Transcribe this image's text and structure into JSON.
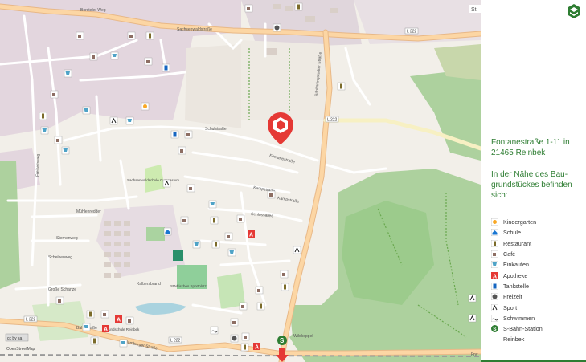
{
  "map": {
    "roads": [
      "Sachsenwaldstraße",
      "Borsteler Weg",
      "Schulstraße",
      "Schönningstedter Straße",
      "Fontanestraße",
      "Mühlenredder",
      "Kampstraße",
      "Sternenweg",
      "Scheibenweg",
      "Schlossallee",
      "Kalbersbrand",
      "Hamburger Straße",
      "Große Schanze",
      "Bahnstraße",
      "Wildkoppel",
      "Freiheitsweg",
      "Kampstraße"
    ],
    "road_badges": [
      "L 222",
      "L 222",
      "L 222",
      "L 222"
    ],
    "places": [
      "Grundschule Reinbek",
      "Sachsenwaldschule Gymnasium",
      "Städtisches Sportplatz"
    ],
    "attribution": "OpenStreetMap",
    "license_badge": "cc by sa",
    "top_label": "St",
    "bottom_label": "Fnv"
  },
  "colors": {
    "accent": "#2e7d32",
    "marker": "#e53935"
  },
  "sidebar": {
    "address_line1": "Fontanestraße 1-11 in",
    "address_line2": "21465 Reinbek",
    "intro_line1": "In der Nähe des Bau-",
    "intro_line2": "grundstückes befinden",
    "intro_line3": "sich:"
  },
  "legend": [
    {
      "icon": "kindergarten-icon",
      "label": "Kindergarten"
    },
    {
      "icon": "school-icon",
      "label": "Schule"
    },
    {
      "icon": "restaurant-icon",
      "label": "Restaurant"
    },
    {
      "icon": "cafe-icon",
      "label": "Café"
    },
    {
      "icon": "shopping-cart-icon",
      "label": "Einkaufen"
    },
    {
      "icon": "pharmacy-icon",
      "label": "Apotheke"
    },
    {
      "icon": "fuel-station-icon",
      "label": "Tankstelle"
    },
    {
      "icon": "leisure-icon",
      "label": "Freizeit"
    },
    {
      "icon": "sport-icon",
      "label": "Sport"
    },
    {
      "icon": "swimming-icon",
      "label": "Schwimmen"
    },
    {
      "icon": "s-bahn-icon",
      "label": "S-Bahn-Station"
    },
    {
      "icon": "",
      "label": "Reinbek"
    }
  ]
}
